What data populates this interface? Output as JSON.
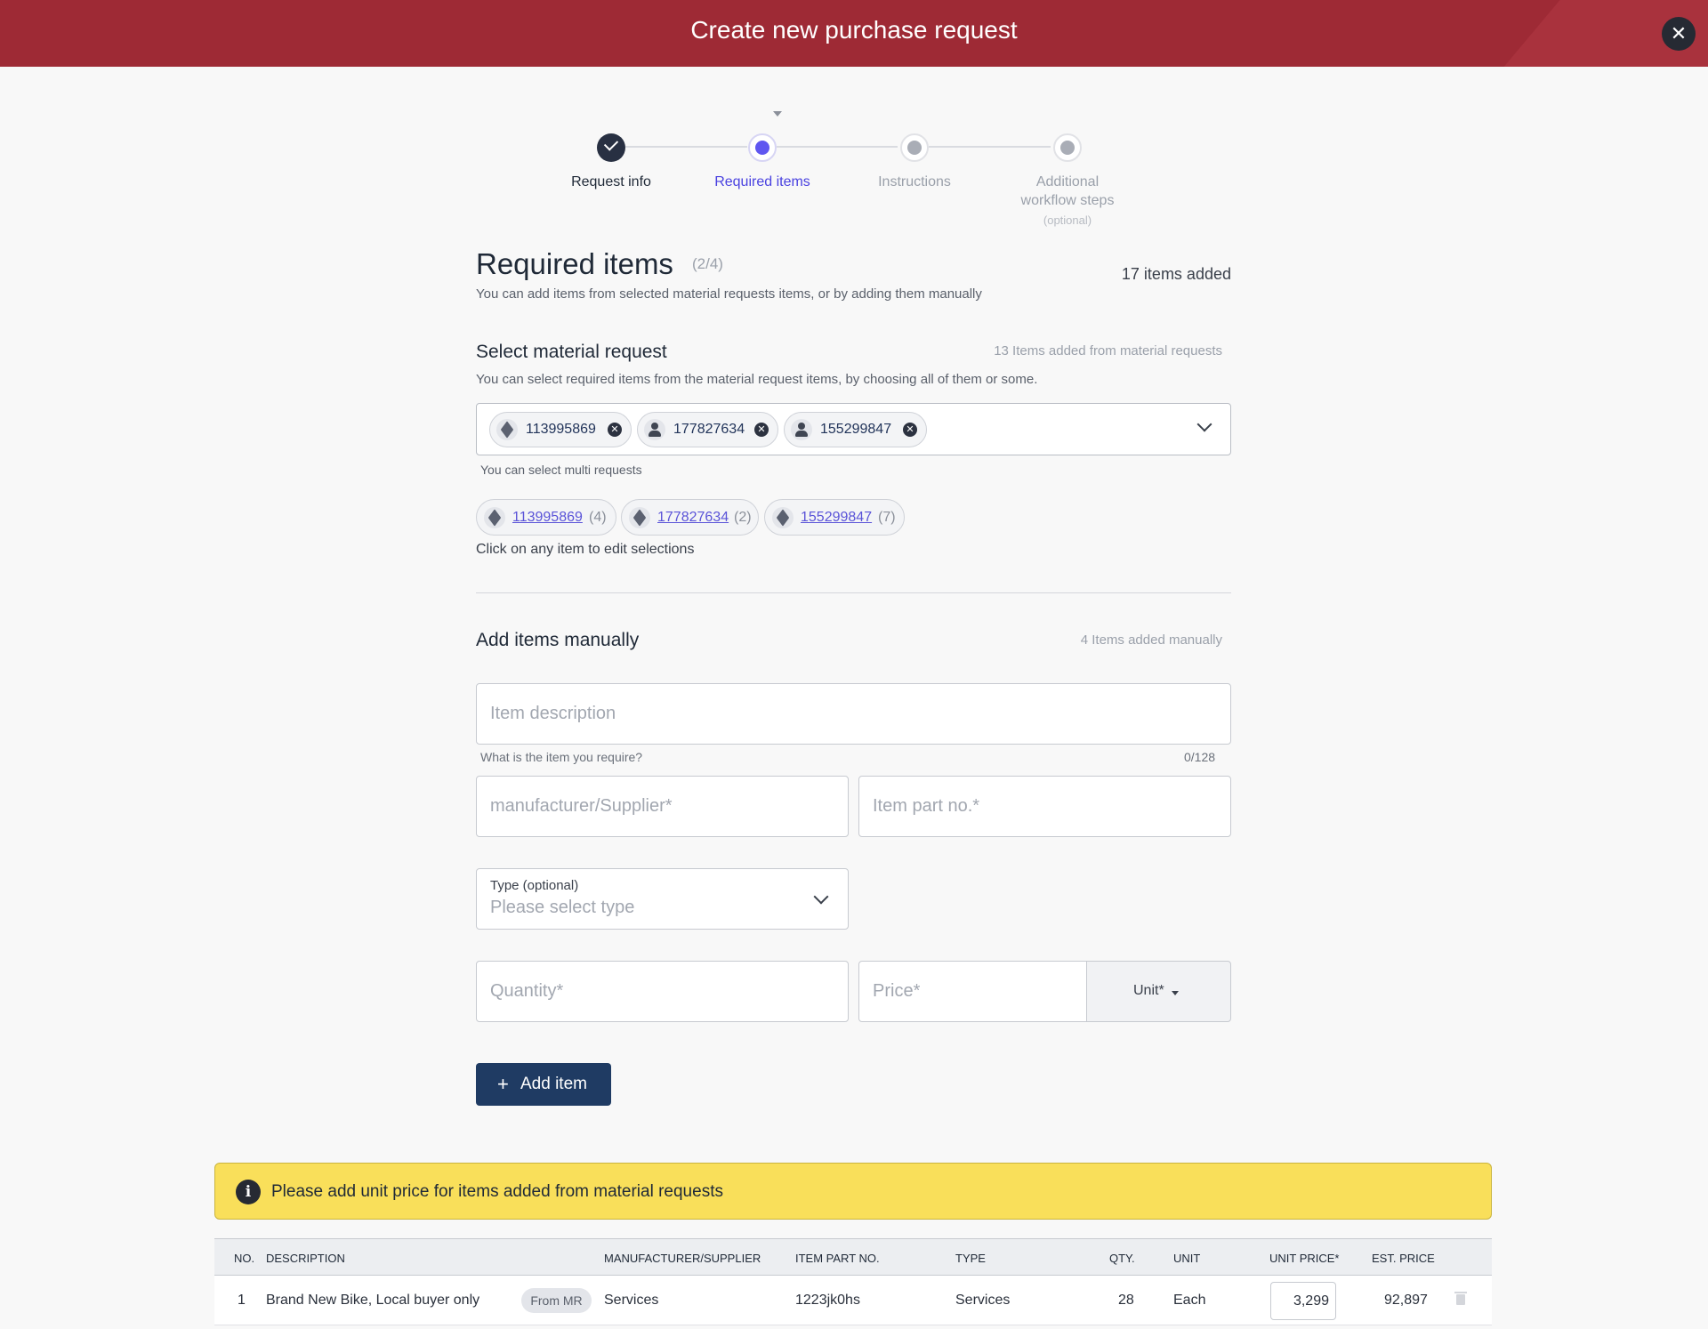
{
  "header": {
    "title": "Create new purchase request",
    "close_icon": "close-icon"
  },
  "stepper": {
    "steps": [
      {
        "label": "Request info",
        "state": "done"
      },
      {
        "label": "Required items",
        "state": "active"
      },
      {
        "label": "Instructions",
        "state": "todo"
      },
      {
        "label": "Additional workflow steps",
        "sub": "(optional)",
        "state": "todo"
      }
    ]
  },
  "page": {
    "title": "Required items",
    "step_count": "(2/4)",
    "items_added": "17 items added",
    "subtitle": "You can add items from selected material requests items, or by adding them manually"
  },
  "material_request": {
    "title": "Select material request",
    "count_note": "13 Items added from material requests",
    "description": "You can select required items from the material request items, by choosing all of them or some.",
    "chips": [
      {
        "id": "113995869",
        "icon": "package-icon"
      },
      {
        "id": "177827634",
        "icon": "person-icon"
      },
      {
        "id": "155299847",
        "icon": "person-icon"
      }
    ],
    "helper": "You can select multi requests",
    "selected": [
      {
        "id": "113995869",
        "count": "(4)"
      },
      {
        "id": "177827634",
        "count": "(2)"
      },
      {
        "id": "155299847",
        "count": "(7)"
      }
    ],
    "edit_hint": "Click on any item to edit selections"
  },
  "manual": {
    "title": "Add items manually",
    "count_note": "4 Items added manually",
    "description_placeholder": "Item description",
    "description_helper": "What is the item you require?",
    "description_counter": "0/128",
    "manufacturer_placeholder": "manufacturer/Supplier*",
    "part_placeholder": "Item part no.*",
    "type_label": "Type (optional)",
    "type_placeholder": "Please select type",
    "quantity_placeholder": "Quantity*",
    "price_placeholder": "Price*",
    "unit_label": "Unit*",
    "add_button": "Add item"
  },
  "warning": {
    "text": "Please add unit price for items added from material requests"
  },
  "table": {
    "headers": {
      "no": "NO.",
      "description": "DESCRIPTION",
      "manufacturer": "MANUFACTURER/SUPPLIER",
      "part": "ITEM PART NO.",
      "type": "TYPE",
      "qty": "QTY.",
      "unit": "UNIT",
      "unit_price": "UNIT PRICE*",
      "est_price": "EST. PRICE"
    },
    "rows": [
      {
        "no": "1",
        "description": "Brand New Bike, Local buyer only",
        "badge": "From MR",
        "manufacturer": "Services",
        "part": "1223jk0hs",
        "type": "Services",
        "qty": "28",
        "unit": "Each",
        "unit_price": "3,299",
        "est_price": "92,897"
      }
    ]
  }
}
